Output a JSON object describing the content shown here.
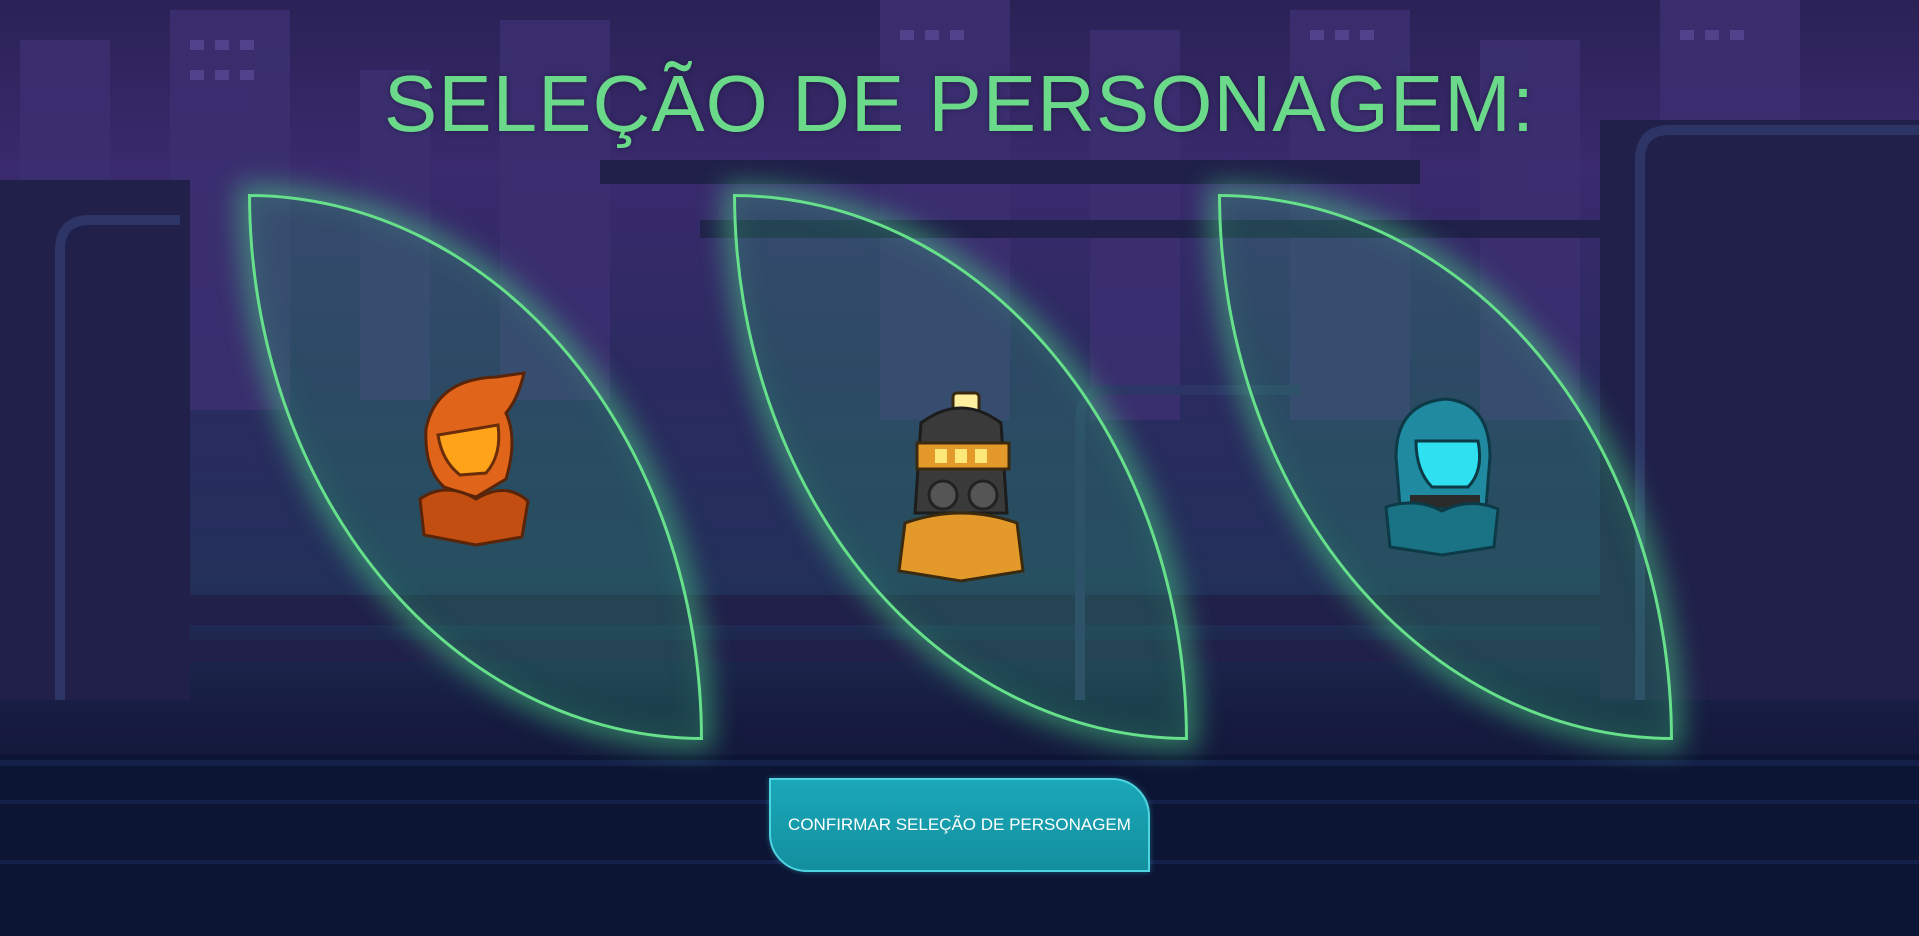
{
  "screen": {
    "title": "SELEÇÃO DE PERSONAGEM:",
    "confirm_label": "CONFIRMAR SELEÇÃO DE PERSONAGEM"
  },
  "characters": [
    {
      "icon": "orange-helmet-icon",
      "color": "#e0641a"
    },
    {
      "icon": "miner-helmet-icon",
      "color": "#e39a2a"
    },
    {
      "icon": "cyan-helmet-icon",
      "color": "#1f8aa0"
    }
  ],
  "colors": {
    "accent_green": "#6bd98a",
    "button_teal": "#138f9f",
    "background": "#1a1740"
  }
}
